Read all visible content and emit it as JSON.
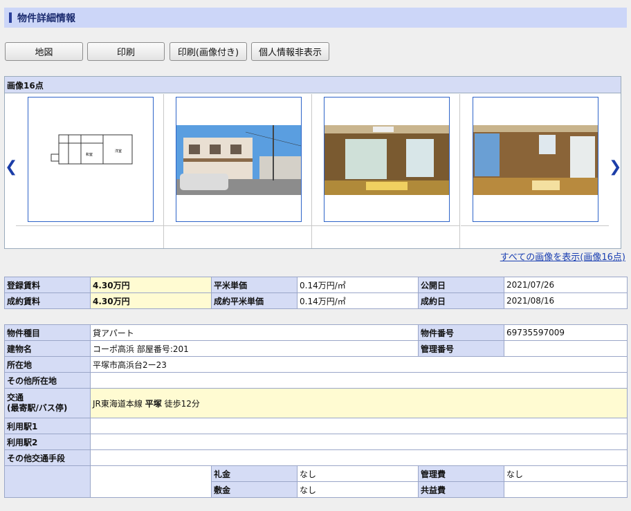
{
  "title": "物件詳細情報",
  "buttons": {
    "map": "地図",
    "print": "印刷",
    "print_img": "印刷(画像付き)",
    "hide_personal": "個人情報非表示"
  },
  "gallery": {
    "header": "画像16点",
    "images": [
      "floorplan",
      "exterior-photo",
      "interior-room-1",
      "interior-room-2"
    ],
    "floorplan_labels": {
      "room_a": "和室",
      "room_b": "洋室"
    },
    "show_all": "すべての画像を表示(画像16点)"
  },
  "price": {
    "reg_rent_label": "登録賃料",
    "reg_rent": "4.30万円",
    "unit_price_label": "平米単価",
    "unit_price": "0.14万円/㎡",
    "public_date_label": "公開日",
    "public_date": "2021/07/26",
    "contract_rent_label": "成約賃料",
    "contract_rent": "4.30万円",
    "contract_unit_label": "成約平米単価",
    "contract_unit": "0.14万円/㎡",
    "contract_date_label": "成約日",
    "contract_date": "2021/08/16"
  },
  "detail": {
    "type_label": "物件種目",
    "type": "貸アパート",
    "number_label": "物件番号",
    "number": "69735597009",
    "building_label": "建物名",
    "building": "コーポ高浜 部屋番号:201",
    "mgmt_no_label": "管理番号",
    "mgmt_no": "",
    "address_label": "所在地",
    "address": "平塚市高浜台2ー23",
    "other_address_label": "その他所在地",
    "other_address": "",
    "transport_label_1": "交通",
    "transport_label_2": "(最寄駅/バス停)",
    "transport_line": "JR東海道本線",
    "transport_station": "平塚",
    "transport_walk": "徒歩12分",
    "station1_label": "利用駅1",
    "station1": "",
    "station2_label": "利用駅2",
    "station2": "",
    "other_transport_label": "その他交通手段",
    "other_transport": "",
    "reikin_label": "礼金",
    "reikin": "なし",
    "kanrihi_label": "管理費",
    "kanrihi": "なし",
    "shikikin_label": "敷金",
    "shikikin": "なし",
    "kyoekihi_label": "共益費",
    "kyoekihi": ""
  }
}
